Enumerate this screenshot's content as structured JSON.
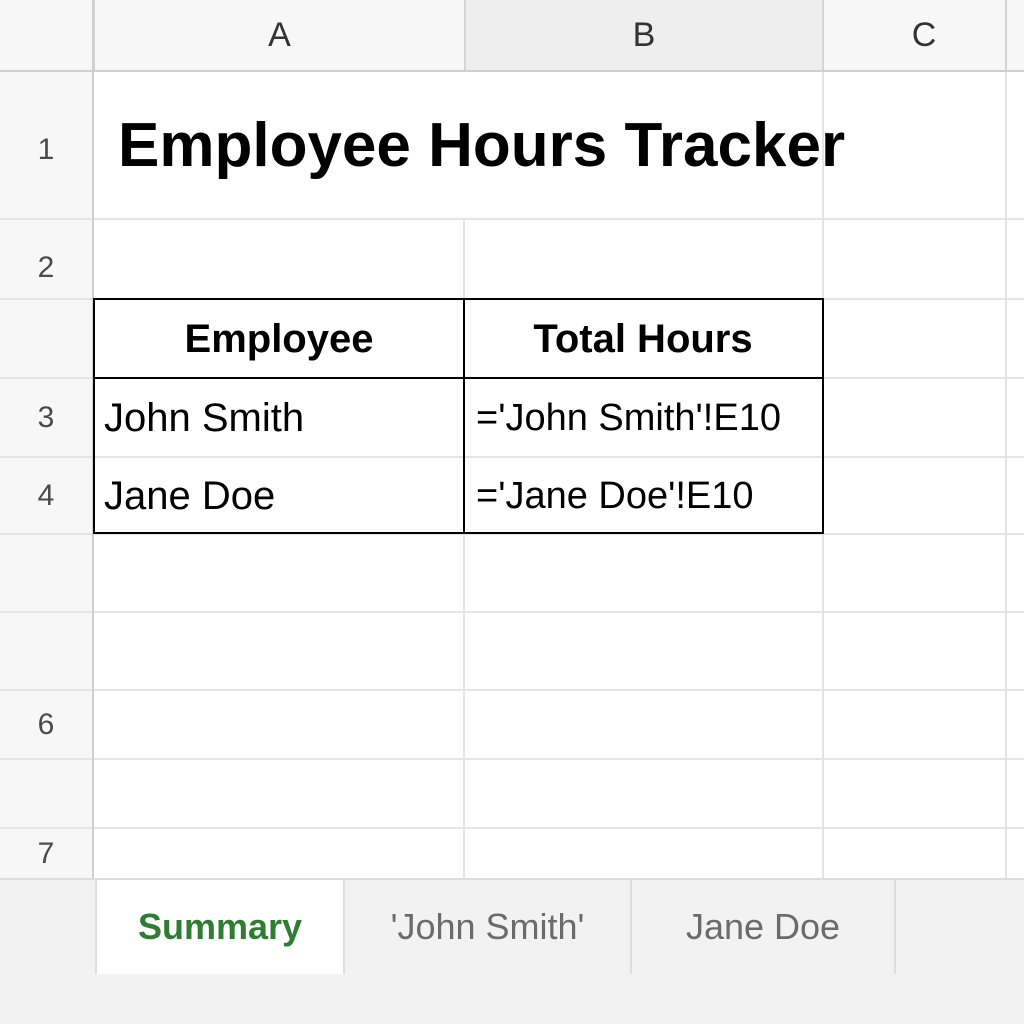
{
  "columns": {
    "a": "A",
    "b": "B",
    "c": "C"
  },
  "rows": {
    "r1": "1",
    "r2": "2",
    "r3": "3",
    "r4": "4",
    "r6": "6",
    "r7": "7"
  },
  "title": "Employee Hours Tracker",
  "table": {
    "headers": {
      "employee": "Employee",
      "total_hours": "Total Hours"
    },
    "rows": [
      {
        "employee": "John Smith",
        "total_hours": "='John Smith'!E10"
      },
      {
        "employee": "Jane Doe",
        "total_hours": "='Jane Doe'!E10"
      }
    ]
  },
  "tabs": [
    {
      "label": "Summary",
      "active": true
    },
    {
      "label": "'John Smith'",
      "active": false
    },
    {
      "label": "Jane Doe",
      "active": false
    }
  ],
  "colors": {
    "active_tab": "#2e7d32",
    "header_bg": "#f7f7f7",
    "selected_column_bg": "#eeeeee"
  }
}
